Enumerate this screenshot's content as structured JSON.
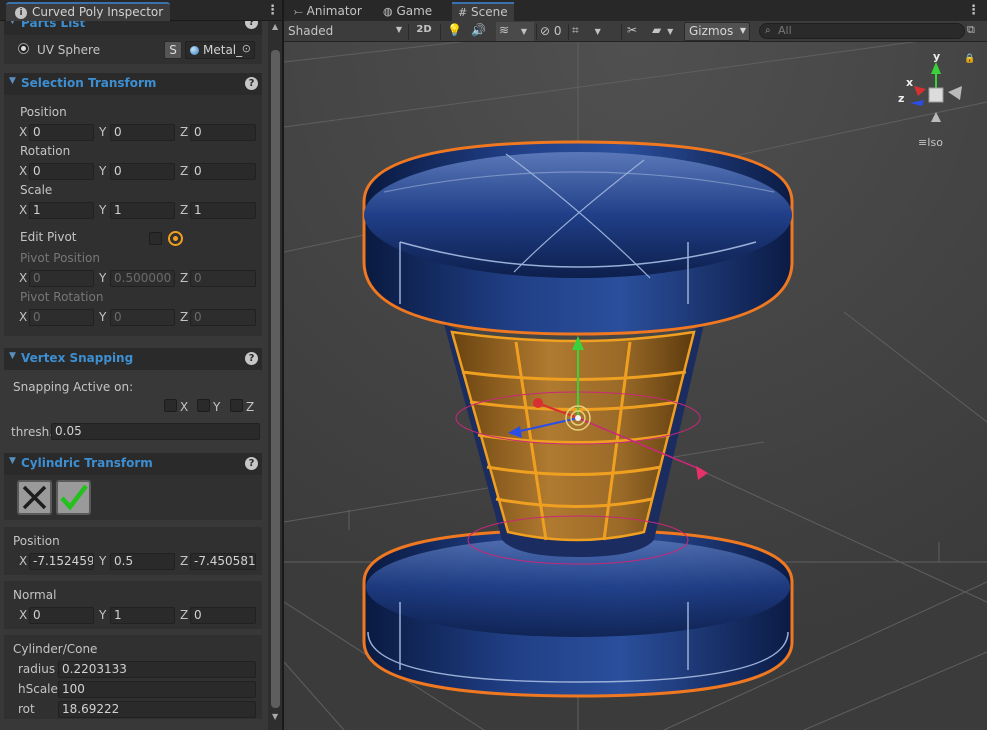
{
  "inspector": {
    "tab_title": "Curved Poly Inspector",
    "parts_list": {
      "header": "Parts List",
      "item_label": "UV Sphere",
      "s_button": "S",
      "material": "Metal_"
    },
    "selection_transform": {
      "header": "Selection Transform",
      "position_label": "Position",
      "position": {
        "x": "0",
        "y": "0",
        "z": "0"
      },
      "rotation_label": "Rotation",
      "rotation": {
        "x": "0",
        "y": "0",
        "z": "0"
      },
      "scale_label": "Scale",
      "scale": {
        "x": "1",
        "y": "1",
        "z": "1"
      },
      "edit_pivot_label": "Edit Pivot",
      "pivot_position_label": "Pivot Position",
      "pivot_position": {
        "x": "0",
        "y": "0.500000",
        "z": "0"
      },
      "pivot_rotation_label": "Pivot Rotation",
      "pivot_rotation": {
        "x": "0",
        "y": "0",
        "z": "0"
      }
    },
    "vertex_snapping": {
      "header": "Vertex Snapping",
      "snapping_label": "Snapping Active on:",
      "axis_x": "X",
      "axis_y": "Y",
      "axis_z": "Z",
      "thresh_label": "thresh.",
      "thresh_value": "0.05"
    },
    "cylindric_transform": {
      "header": "Cylindric Transform",
      "position_label": "Position",
      "position": {
        "x": "-7.152459",
        "y": "0.5",
        "z": "-7.450581"
      },
      "normal_label": "Normal",
      "normal": {
        "x": "0",
        "y": "1",
        "z": "0"
      },
      "cylinder_label": "Cylinder/Cone",
      "radius_label": "radius",
      "radius_value": "0.2203133",
      "hscale_label": "hScale",
      "hscale_value": "100",
      "rot_label": "rot",
      "rot_value": "18.69222"
    },
    "axis_labels": {
      "x": "X",
      "y": "Y",
      "z": "Z"
    }
  },
  "scene_view": {
    "tabs": [
      {
        "label": "Animator",
        "icon": "animator-icon"
      },
      {
        "label": "Game",
        "icon": "gamepad-icon"
      },
      {
        "label": "Scene",
        "icon": "grid-icon",
        "active": true
      }
    ],
    "toolbar": {
      "shading_mode": "Shaded",
      "mode_2d": "2D",
      "hidden_count": "0",
      "gizmos_label": "Gizmos",
      "search_placeholder": "All"
    },
    "orientation_gizmo": {
      "x_label": "x",
      "y_label": "y",
      "z_label": "z",
      "projection_label": "Iso"
    }
  },
  "colors": {
    "selection_outline": "#f07820",
    "header_text": "#3d8fd2",
    "tab_accent": "#3a72b0",
    "mesh_blue": "#1d3f82",
    "mesh_orange": "#b07a30",
    "confirm_green": "#22c11e"
  }
}
